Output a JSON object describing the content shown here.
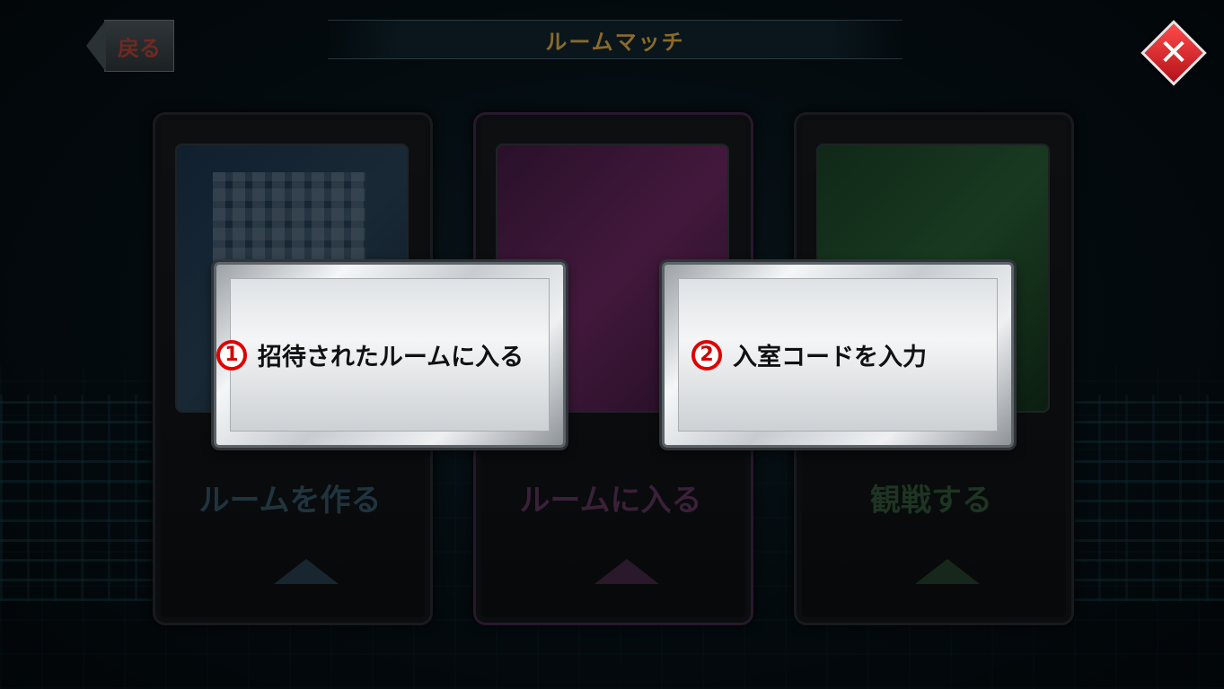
{
  "header": {
    "back_label": "戻る",
    "title": "ルームマッチ",
    "close_symbol": "✕"
  },
  "cards": {
    "create": {
      "label": "ルームを作る",
      "accent": "#3b5f74"
    },
    "join": {
      "label": "ルームに入る",
      "accent": "#6a3b67"
    },
    "watch": {
      "label": "観戦する",
      "accent": "#35613f"
    }
  },
  "dialog": {
    "invited": {
      "number": "1",
      "label": "招待されたルームに入る"
    },
    "code": {
      "number": "2",
      "label": "入室コードを入力"
    }
  },
  "colors": {
    "badge_red": "#e10000",
    "close_red": "#d9252a",
    "title_gold": "#8a6a2a"
  }
}
